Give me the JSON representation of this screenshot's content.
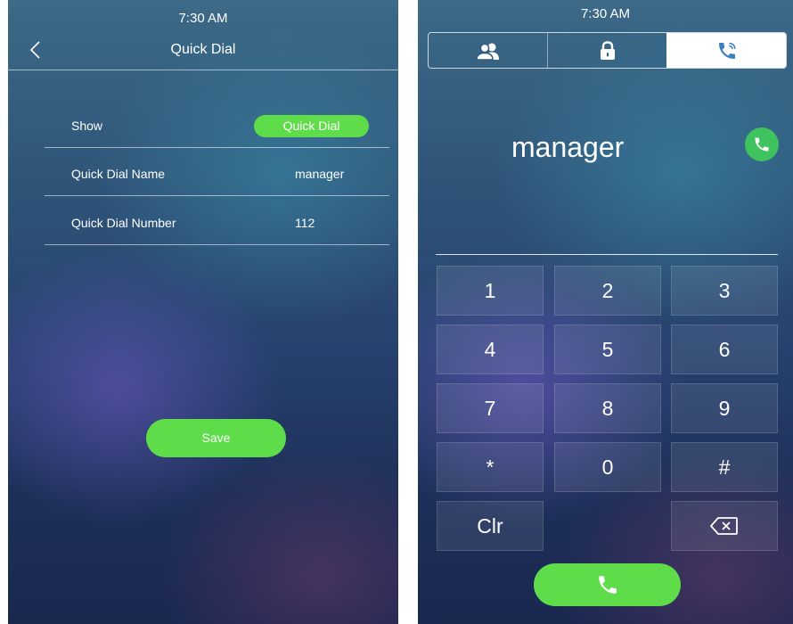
{
  "left_screen": {
    "status_time": "7:30 AM",
    "title": "Quick Dial",
    "rows": [
      {
        "label": "Show",
        "value": "Quick Dial"
      },
      {
        "label": "Quick Dial Name",
        "value": "manager"
      },
      {
        "label": "Quick Dial Number",
        "value": "112"
      }
    ],
    "save_label": "Save"
  },
  "right_screen": {
    "status_time": "7:30 AM",
    "tabs": [
      {
        "icon": "contacts-icon",
        "active": false
      },
      {
        "icon": "lock-icon",
        "active": false
      },
      {
        "icon": "phone-ringing-icon",
        "active": true
      }
    ],
    "contact_name": "manager",
    "keypad": {
      "digits": [
        "1",
        "2",
        "3",
        "4",
        "5",
        "6",
        "7",
        "8",
        "9",
        "*",
        "0",
        "#"
      ],
      "clear_label": "Clr"
    }
  },
  "colors": {
    "accent_green": "#5fdc4a",
    "call_green": "#3ec35e",
    "active_tab_icon": "#3a7fc0"
  }
}
